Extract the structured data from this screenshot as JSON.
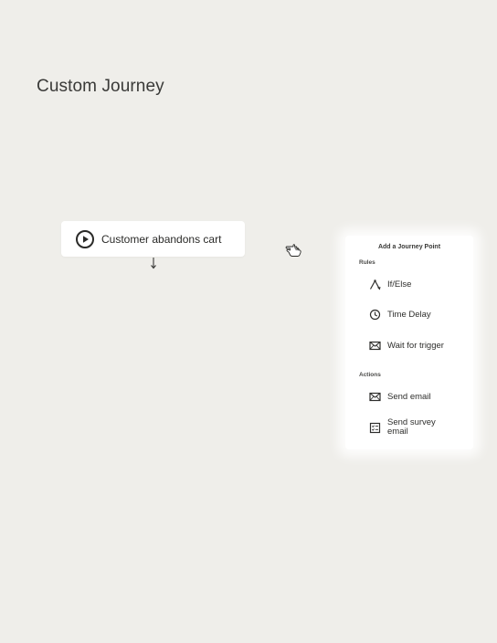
{
  "page": {
    "title": "Custom Journey"
  },
  "trigger": {
    "icon": "play-circle-icon",
    "label": "Customer abandons cart"
  },
  "cursor": {
    "icon": "hand-pointer-icon"
  },
  "panel": {
    "title": "Add a Journey Point",
    "sections": [
      {
        "heading": "Rules",
        "items": [
          {
            "icon": "split-branch-icon",
            "label": "If/Else"
          },
          {
            "icon": "clock-icon",
            "label": "Time Delay"
          },
          {
            "icon": "envelope-icon",
            "label": "Wait for trigger"
          }
        ]
      },
      {
        "heading": "Actions",
        "items": [
          {
            "icon": "envelope-icon",
            "label": "Send email"
          },
          {
            "icon": "survey-form-icon",
            "label": "Send survey email"
          }
        ]
      }
    ]
  },
  "colors": {
    "background": "#efeeea",
    "card": "#ffffff",
    "text": "#2e2e2c"
  }
}
